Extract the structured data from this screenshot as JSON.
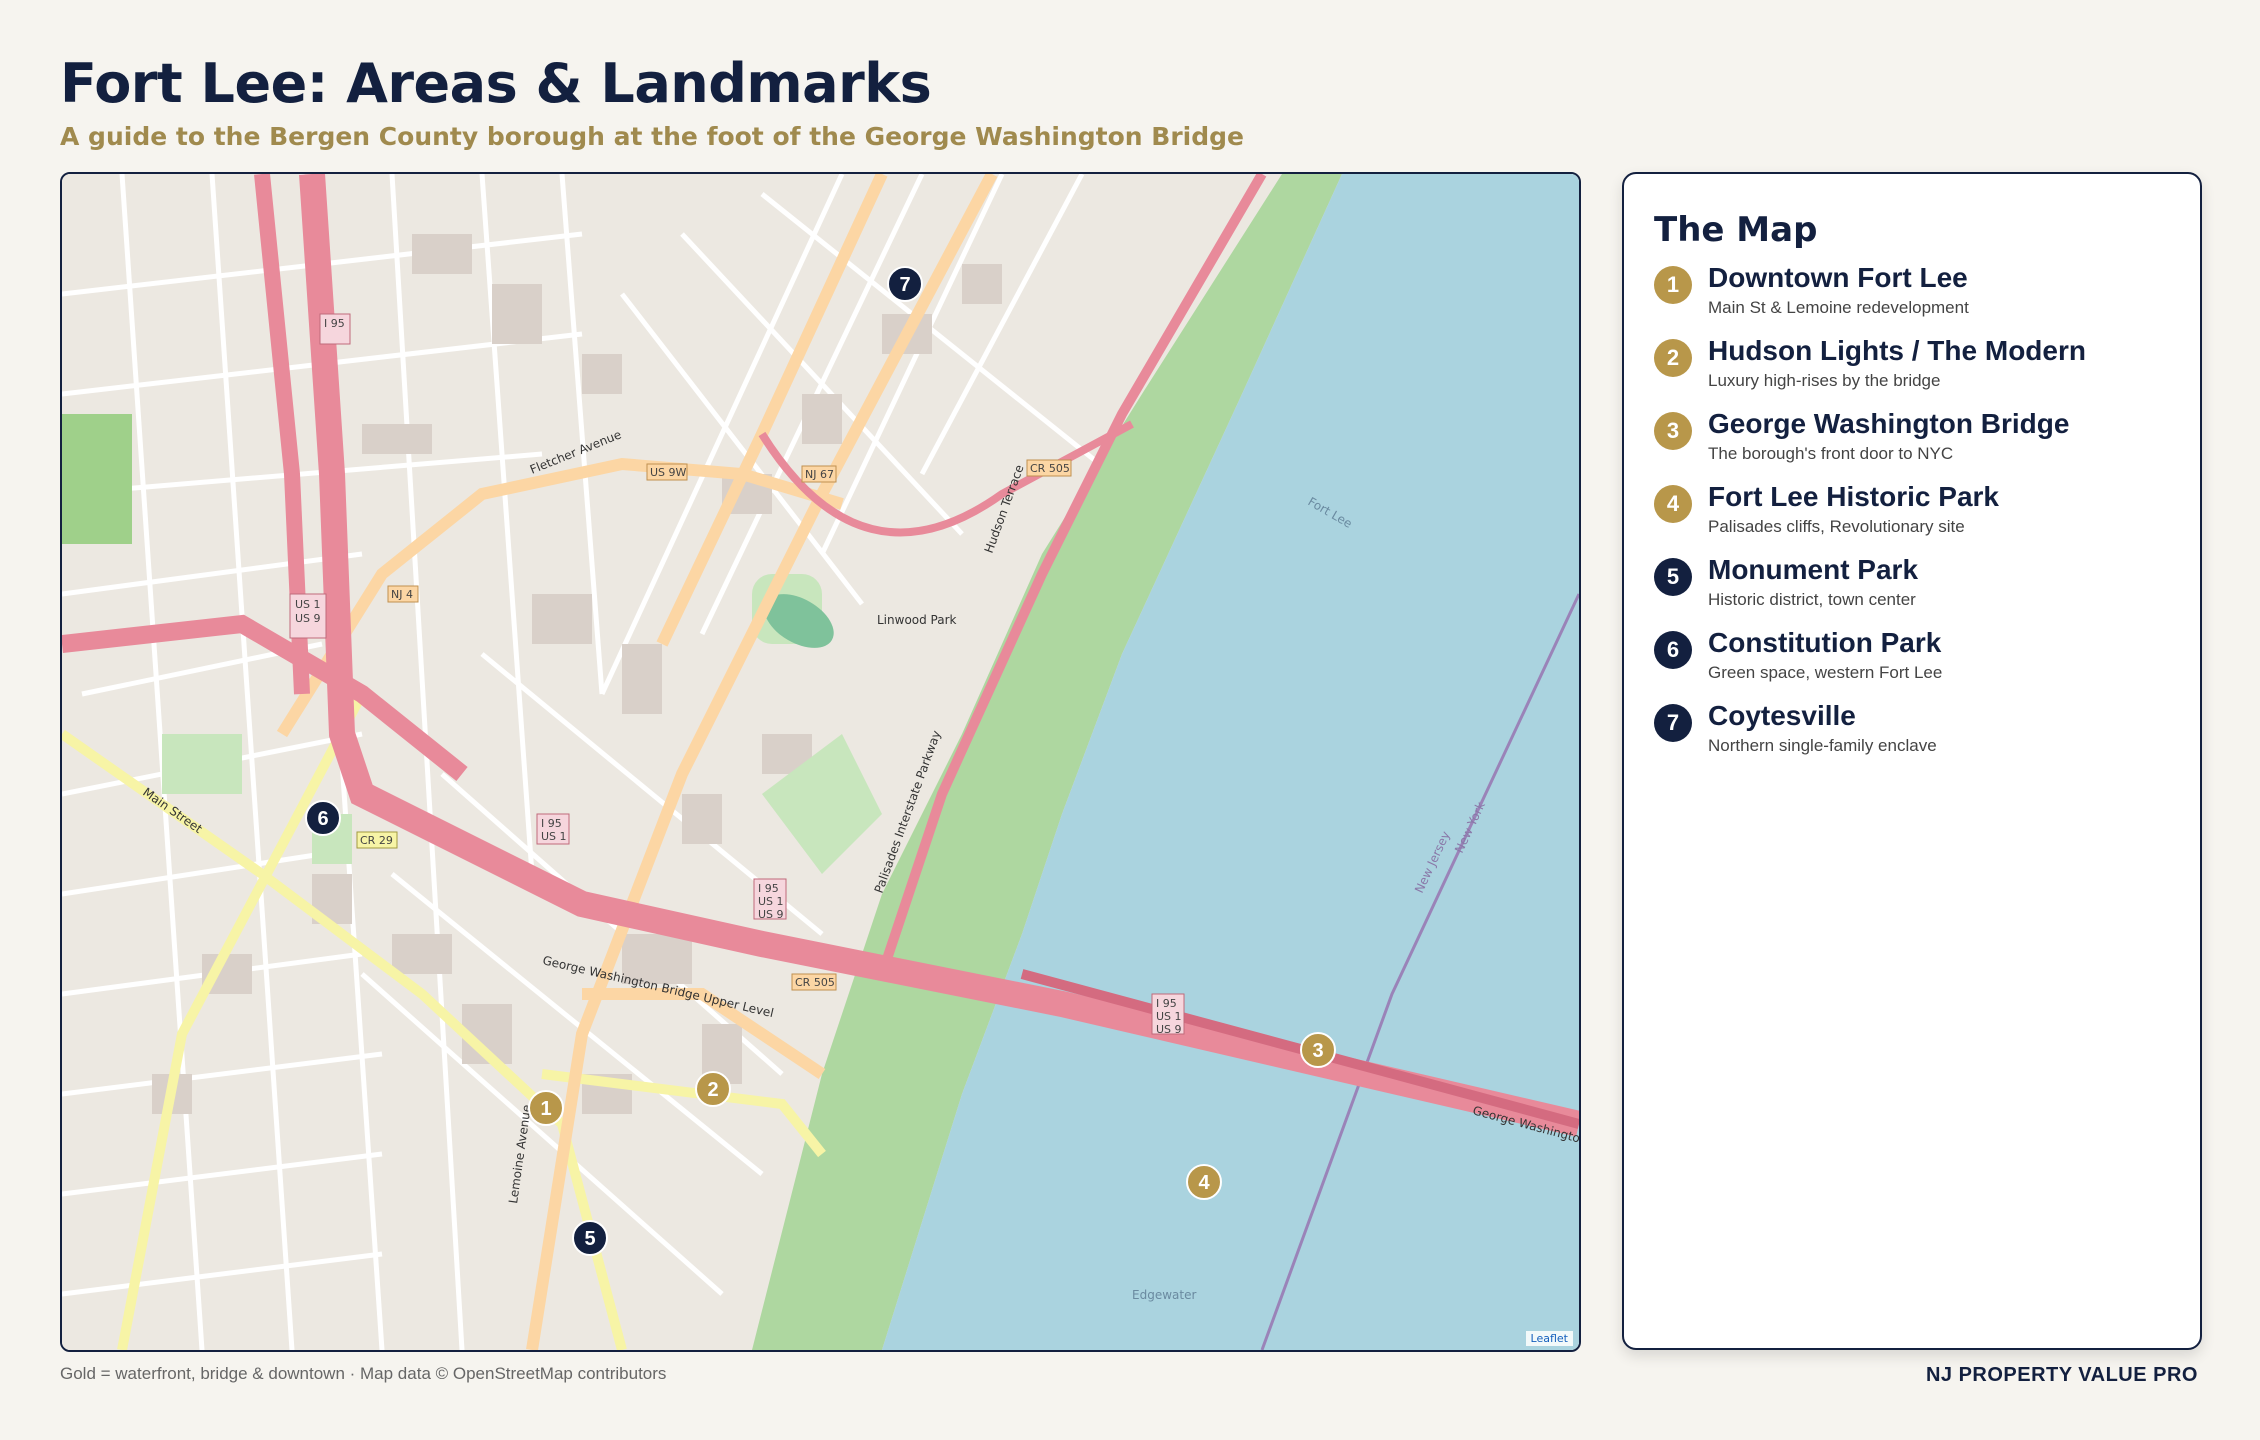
{
  "header": {
    "title": "Fort Lee: Areas & Landmarks",
    "subtitle": "A guide to the Bergen County borough at the foot of the George Washington Bridge"
  },
  "colors": {
    "navy": "#13203f",
    "gold": "#b8974a",
    "water": "#aad3df",
    "park": "#aed7a0",
    "highway": "#e88a9a"
  },
  "legend": {
    "title": "The Map",
    "items": [
      {
        "num": "1",
        "name": "Downtown Fort Lee",
        "desc": "Main St & Lemoine redevelopment",
        "style": "gold"
      },
      {
        "num": "2",
        "name": "Hudson Lights / The Modern",
        "desc": "Luxury high-rises by the bridge",
        "style": "gold"
      },
      {
        "num": "3",
        "name": "George Washington Bridge",
        "desc": "The borough's front door to NYC",
        "style": "gold"
      },
      {
        "num": "4",
        "name": "Fort Lee Historic Park",
        "desc": "Palisades cliffs, Revolutionary site",
        "style": "gold"
      },
      {
        "num": "5",
        "name": "Monument Park",
        "desc": "Historic district, town center",
        "style": "navy"
      },
      {
        "num": "6",
        "name": "Constitution Park",
        "desc": "Green space, western Fort Lee",
        "style": "navy"
      },
      {
        "num": "7",
        "name": "Coytesville",
        "desc": "Northern single-family enclave",
        "style": "navy"
      }
    ]
  },
  "map": {
    "attribution": "Leaflet",
    "labels": {
      "gwb": "George Washington Bridge",
      "gwb_upper": "George Washington Bridge Upper Level",
      "lemoine": "Lemoine Avenue",
      "main_street": "Main Street",
      "palisades_parkway": "Palisades Interstate Parkway",
      "hudson_terrace": "Hudson Terrace",
      "linwood_park": "Linwood Park",
      "fletcher_avenue": "Fletcher Avenue",
      "edgewater": "Edgewater",
      "fort_lee": "Fort Lee",
      "new_jersey": "New Jersey",
      "new_york": "New York",
      "i95_shield": "I 95",
      "us1_shield": "US 1",
      "us9_shield": "US 9",
      "us9w": "US 9W",
      "nj67": "NJ 67",
      "nj4": "NJ 4",
      "cr505": "CR 505",
      "cr29": "CR 29"
    },
    "markers": [
      {
        "num": "1",
        "style": "gold"
      },
      {
        "num": "2",
        "style": "gold"
      },
      {
        "num": "3",
        "style": "gold"
      },
      {
        "num": "4",
        "style": "gold"
      },
      {
        "num": "5",
        "style": "navy"
      },
      {
        "num": "6",
        "style": "navy"
      },
      {
        "num": "7",
        "style": "navy"
      }
    ]
  },
  "footer": {
    "note": "Gold = waterfront, bridge & downtown · Map data © OpenStreetMap contributors",
    "brand": "NJ PROPERTY VALUE PRO"
  }
}
